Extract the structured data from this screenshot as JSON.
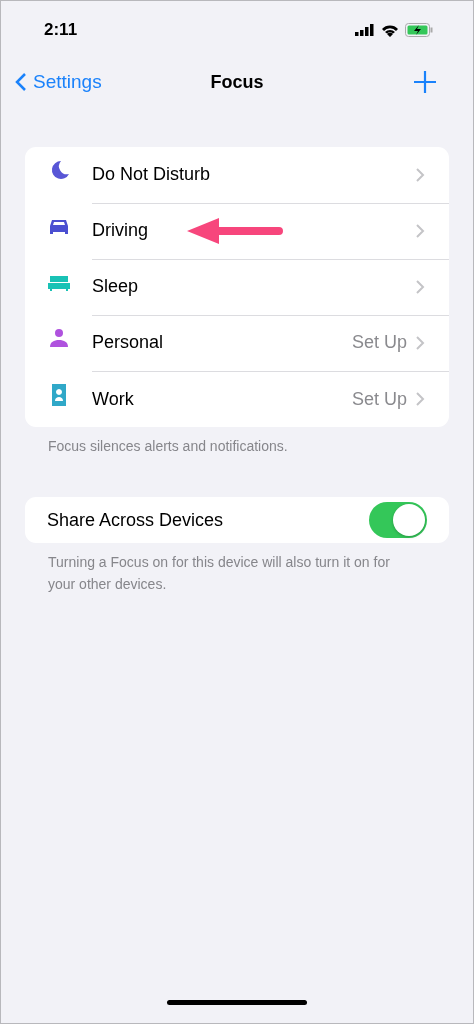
{
  "status_bar": {
    "time": "2:11"
  },
  "nav": {
    "back": "Settings",
    "title": "Focus"
  },
  "focus_list": {
    "items": [
      {
        "label": "Do Not Disturb",
        "kind": "moon",
        "color": "#5856d6"
      },
      {
        "label": "Driving",
        "kind": "car",
        "color": "#4b4fd1",
        "annotated": true
      },
      {
        "label": "Sleep",
        "kind": "bed",
        "color": "#19c2b5"
      },
      {
        "label": "Personal",
        "kind": "person",
        "color": "#af52de",
        "detail": "Set Up"
      },
      {
        "label": "Work",
        "kind": "badge",
        "color": "#30a8c8",
        "detail": "Set Up"
      }
    ],
    "footer": "Focus silences alerts and notifications."
  },
  "share": {
    "label": "Share Across Devices",
    "on": true,
    "footer": "Turning a Focus on for this device will also turn it on for your other devices."
  }
}
